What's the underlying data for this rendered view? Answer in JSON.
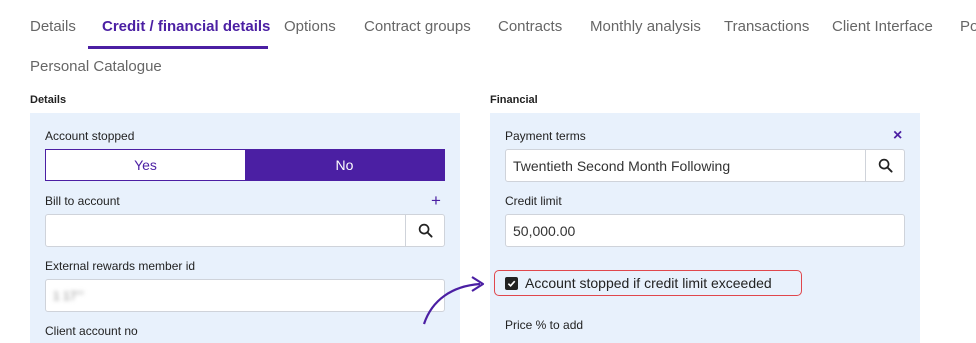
{
  "tabs": [
    {
      "label": "Details"
    },
    {
      "label": "Credit / financial details"
    },
    {
      "label": "Options"
    },
    {
      "label": "Contract groups"
    },
    {
      "label": "Contracts"
    },
    {
      "label": "Monthly analysis"
    },
    {
      "label": "Transactions"
    },
    {
      "label": "Client Interface"
    },
    {
      "label": "Po"
    },
    {
      "label": "Personal Catalogue"
    }
  ],
  "active_tab": "Credit / financial details",
  "details": {
    "title": "Details",
    "account_stopped_label": "Account stopped",
    "yes_label": "Yes",
    "no_label": "No",
    "selected": "No",
    "bill_to_label": "Bill to account",
    "bill_to_value": "",
    "external_rewards_label": "External rewards member id",
    "external_rewards_value": "1 17’’’",
    "client_account_label": "Client account no"
  },
  "financial": {
    "title": "Financial",
    "payment_terms_label": "Payment terms",
    "payment_terms_value": "Twentieth Second Month Following",
    "credit_limit_label": "Credit limit",
    "credit_limit_value": "50,000.00",
    "stop_if_exceeded_label": "Account stopped if credit limit exceeded",
    "stop_if_exceeded_checked": true,
    "price_pct_label": "Price % to add"
  },
  "accent_color": "#4b1fa3",
  "highlight_color": "#e0474c"
}
